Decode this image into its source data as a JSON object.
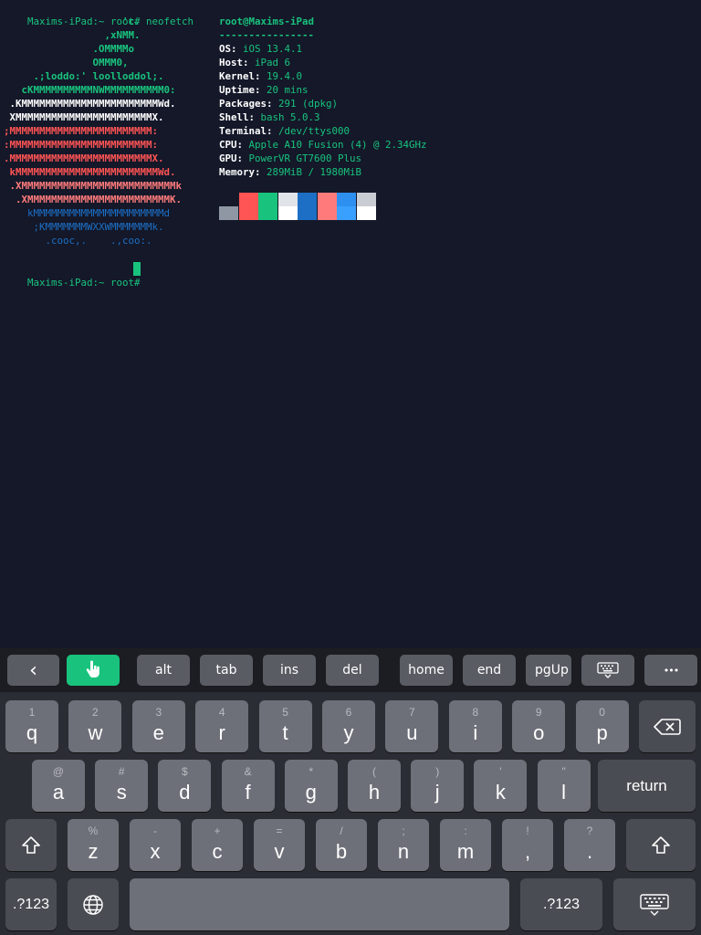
{
  "terminal": {
    "prompt": "Maxims-iPad:~ root#",
    "command": "neofetch",
    "logo": [
      {
        "text": "                    'c.",
        "cls": "logo"
      },
      {
        "text": "                 ,xNMM.",
        "cls": "logo"
      },
      {
        "text": "               .OMMMMo",
        "cls": "logo"
      },
      {
        "text": "               OMMM0,",
        "cls": "logo"
      },
      {
        "text": "     .;loddo:' loolloddol;.",
        "cls": "logo"
      },
      {
        "text": "   cKMMMMMMMMMMNWMMMMMMMMMM0:",
        "cls": "logo"
      },
      {
        "text": " .KMMMMMMMMMMMMMMMMMMMMMMMWd.",
        "cls": "logo-w"
      },
      {
        "text": " XMMMMMMMMMMMMMMMMMMMMMMMX.",
        "cls": "logo-w"
      },
      {
        "text": ";MMMMMMMMMMMMMMMMMMMMMMMM:",
        "cls": "logo-r"
      },
      {
        "text": ":MMMMMMMMMMMMMMMMMMMMMMMM:",
        "cls": "logo-r"
      },
      {
        "text": ".MMMMMMMMMMMMMMMMMMMMMMMMX.",
        "cls": "logo-r"
      },
      {
        "text": " kMMMMMMMMMMMMMMMMMMMMMMMMWd.",
        "cls": "logo-r"
      },
      {
        "text": " .XMMMMMMMMMMMMMMMMMMMMMMMMMMk",
        "cls": "logo-p"
      },
      {
        "text": "  .XMMMMMMMMMMMMMMMMMMMMMMMMK.",
        "cls": "logo-p"
      },
      {
        "text": "    kMMMMMMMMMMMMMMMMMMMMMMd",
        "cls": "logo-b"
      },
      {
        "text": "     ;KMMMMMMMWXXWMMMMMMMk.",
        "cls": "logo-b"
      },
      {
        "text": "       .cooc,.    .,coo:.",
        "cls": "logo-b"
      }
    ],
    "title": "root@Maxims-iPad",
    "separator": "----------------",
    "info": [
      {
        "key": "OS",
        "value": "iOS 13.4.1"
      },
      {
        "key": "Host",
        "value": "iPad 6"
      },
      {
        "key": "Kernel",
        "value": "19.4.0"
      },
      {
        "key": "Uptime",
        "value": "20 mins"
      },
      {
        "key": "Packages",
        "value": "291 (dpkg)"
      },
      {
        "key": "Shell",
        "value": "bash 5.0.3"
      },
      {
        "key": "Terminal",
        "value": "/dev/ttys000"
      },
      {
        "key": "CPU",
        "value": "Apple A10 Fusion (4) @ 2.34GHz"
      },
      {
        "key": "GPU",
        "value": "PowerVR GT7600 Plus"
      },
      {
        "key": "Memory",
        "value": "289MiB / 1980MiB"
      }
    ],
    "colors_top": [
      "#141829",
      "#ff5454",
      "#19c37d",
      "#e0e3e8",
      "#1d6fc6",
      "#ff7b7b",
      "#2d8ff0",
      "#c9cdd3"
    ],
    "colors_bottom": [
      "#8e97a3",
      "#ff5454",
      "#19c37d",
      "#ffffff",
      "#1d6fc6",
      "#ff7b7b",
      "#3aa0ff",
      "#ffffff"
    ],
    "prompt2": "Maxims-iPad:~ root#"
  },
  "toolbar": {
    "back": "‹",
    "alt": "alt",
    "tab": "tab",
    "ins": "ins",
    "del": "del",
    "home": "home",
    "end": "end",
    "pgup": "pgUp",
    "more": "•••"
  },
  "keyboard": {
    "row1": [
      {
        "n": "1",
        "l": "q"
      },
      {
        "n": "2",
        "l": "w"
      },
      {
        "n": "3",
        "l": "e"
      },
      {
        "n": "4",
        "l": "r"
      },
      {
        "n": "5",
        "l": "t"
      },
      {
        "n": "6",
        "l": "y"
      },
      {
        "n": "7",
        "l": "u"
      },
      {
        "n": "8",
        "l": "i"
      },
      {
        "n": "9",
        "l": "o"
      },
      {
        "n": "0",
        "l": "p"
      }
    ],
    "row2": [
      {
        "n": "@",
        "l": "a"
      },
      {
        "n": "#",
        "l": "s"
      },
      {
        "n": "$",
        "l": "d"
      },
      {
        "n": "&",
        "l": "f"
      },
      {
        "n": "*",
        "l": "g"
      },
      {
        "n": "(",
        "l": "h"
      },
      {
        "n": ")",
        "l": "j"
      },
      {
        "n": "'",
        "l": "k"
      },
      {
        "n": "\"",
        "l": "l"
      }
    ],
    "row3": [
      {
        "n": "%",
        "l": "z"
      },
      {
        "n": "-",
        "l": "x"
      },
      {
        "n": "+",
        "l": "c"
      },
      {
        "n": "=",
        "l": "v"
      },
      {
        "n": "/",
        "l": "b"
      },
      {
        "n": ";",
        "l": "n"
      },
      {
        "n": ":",
        "l": "m"
      },
      {
        "n": "!",
        "l": ","
      },
      {
        "n": "?",
        "l": "."
      }
    ],
    "return": "return",
    "num_left": ".?123",
    "num_right": ".?123"
  }
}
